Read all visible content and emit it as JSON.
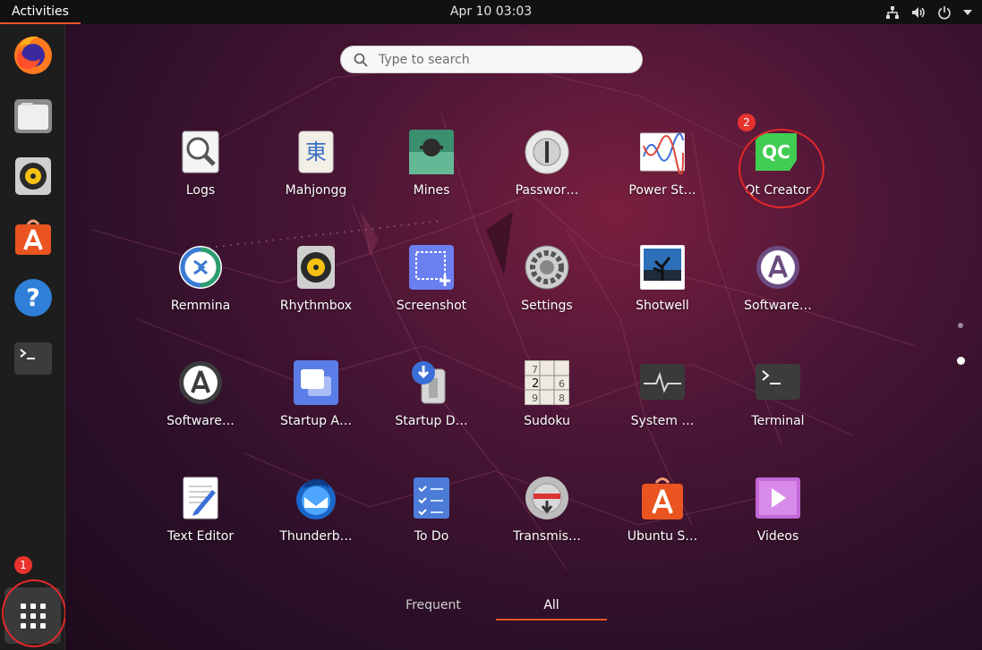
{
  "topbar": {
    "activities": "Activities",
    "clock": "Apr 10  03:03",
    "tray_icons": [
      "network-icon",
      "volume-icon",
      "power-icon",
      "dropdown-arrow-icon"
    ]
  },
  "dock": {
    "items": [
      "firefox-icon",
      "files-icon",
      "rhythmbox-icon",
      "ubuntu-software-icon",
      "help-icon",
      "terminal-icon"
    ],
    "show_apps": "show-applications-icon"
  },
  "search": {
    "placeholder": "Type to search"
  },
  "apps": [
    {
      "label": "Logs",
      "icon": "logs-icon"
    },
    {
      "label": "Mahjongg",
      "icon": "mahjongg-icon"
    },
    {
      "label": "Mines",
      "icon": "mines-icon"
    },
    {
      "label": "Passwor…",
      "icon": "passwords-icon"
    },
    {
      "label": "Power St…",
      "icon": "power-statistics-icon"
    },
    {
      "label": "Qt Creator",
      "icon": "qt-creator-icon"
    },
    {
      "label": "Remmina",
      "icon": "remmina-icon"
    },
    {
      "label": "Rhythmbox",
      "icon": "rhythmbox-icon"
    },
    {
      "label": "Screenshot",
      "icon": "screenshot-icon"
    },
    {
      "label": "Settings",
      "icon": "settings-icon"
    },
    {
      "label": "Shotwell",
      "icon": "shotwell-icon"
    },
    {
      "label": "Software…",
      "icon": "software-updater-icon"
    },
    {
      "label": "Software…",
      "icon": "software-properties-icon"
    },
    {
      "label": "Startup A…",
      "icon": "startup-apps-icon"
    },
    {
      "label": "Startup D…",
      "icon": "startup-disk-icon"
    },
    {
      "label": "Sudoku",
      "icon": "sudoku-icon"
    },
    {
      "label": "System …",
      "icon": "system-monitor-icon"
    },
    {
      "label": "Terminal",
      "icon": "terminal-icon"
    },
    {
      "label": "Text Editor",
      "icon": "text-editor-icon"
    },
    {
      "label": "Thunderb…",
      "icon": "thunderbird-icon"
    },
    {
      "label": "To Do",
      "icon": "todo-icon"
    },
    {
      "label": "Transmis…",
      "icon": "transmission-icon"
    },
    {
      "label": "Ubuntu S…",
      "icon": "ubuntu-software-icon"
    },
    {
      "label": "Videos",
      "icon": "videos-icon"
    }
  ],
  "tabs": {
    "frequent": "Frequent",
    "all": "All",
    "active": "All"
  },
  "annotations": {
    "badge1": "1",
    "badge2": "2"
  },
  "colors": {
    "accent": "#e95420",
    "annotation": "#e3282b"
  },
  "page_indicator": {
    "pages": 2,
    "current": 2
  }
}
